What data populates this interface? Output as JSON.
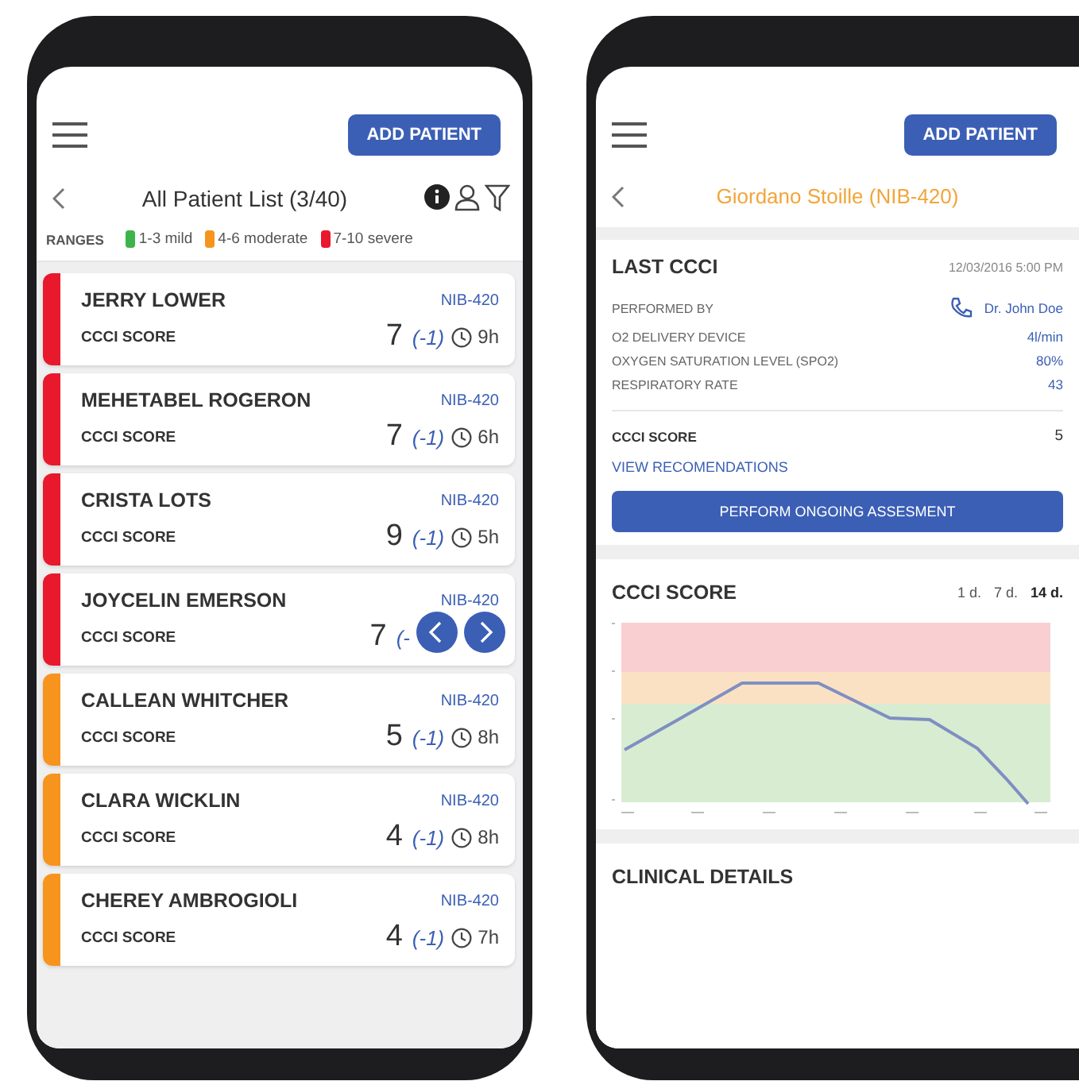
{
  "patient_list": {
    "add_button": "ADD PATIENT",
    "title": "All Patient List (3/40)",
    "ranges_label": "RANGES",
    "ranges": [
      {
        "label": "1-3 mild",
        "color": "#3cb44b"
      },
      {
        "label": "4-6 moderate",
        "color": "#f7941d"
      },
      {
        "label": "7-10 severe",
        "color": "#e8192c"
      }
    ],
    "patients": [
      {
        "name": "JERRY LOWER",
        "id": "NIB-420",
        "score_label": "CCCI SCORE",
        "score": "7",
        "change": "(-1)",
        "time": "9h",
        "color": "#e8192c"
      },
      {
        "name": "MEHETABEL ROGERON",
        "id": "NIB-420",
        "score_label": "CCCI SCORE",
        "score": "7",
        "change": "(-1)",
        "time": "6h",
        "color": "#e8192c"
      },
      {
        "name": "CRISTA LOTS",
        "id": "NIB-420",
        "score_label": "CCCI SCORE",
        "score": "9",
        "change": "(-1)",
        "time": "5h",
        "color": "#e8192c"
      },
      {
        "name": "JOYCELIN EMERSON",
        "id": "NIB-420",
        "score_label": "CCCI SCORE",
        "score": "7",
        "change": "(-",
        "color": "#e8192c"
      },
      {
        "name": "CALLEAN WHITCHER",
        "id": "NIB-420",
        "score_label": "CCCI SCORE",
        "score": "5",
        "change": "(-1)",
        "time": "8h",
        "color": "#f7941d"
      },
      {
        "name": "CLARA WICKLIN",
        "id": "NIB-420",
        "score_label": "CCCI SCORE",
        "score": "4",
        "change": "(-1)",
        "time": "8h",
        "color": "#f7941d"
      },
      {
        "name": "CHEREY AMBROGIOLI",
        "id": "NIB-420",
        "score_label": "CCCI SCORE",
        "score": "4",
        "change": "(-1)",
        "time": "7h",
        "color": "#f7941d"
      }
    ]
  },
  "patient_detail": {
    "add_button": "ADD PATIENT",
    "title": "Giordano Stoille (NIB-420)",
    "last_ccci": {
      "heading": "LAST CCCI",
      "datetime": "12/03/2016 5:00 PM",
      "rows": [
        {
          "kind": "contact",
          "label": "PERFORMED BY",
          "value": "Dr. John Doe"
        },
        {
          "kind": "plain",
          "label": "O2 DELIVERY DEVICE",
          "value": "4l/min"
        },
        {
          "kind": "plain",
          "label": "OXYGEN SATURATION LEVEL (SPO2)",
          "value": "80%"
        },
        {
          "kind": "plain",
          "label": "RESPIRATORY RATE",
          "value": "43"
        }
      ],
      "score_label": "CCCI SCORE",
      "score": "5",
      "link": "VIEW RECOMENDATIONS",
      "action_button": "PERFORM ONGOING ASSESMENT"
    },
    "score_chart": {
      "heading": "CCCI SCORE",
      "ranges": [
        {
          "label": "1 d.",
          "selected": false
        },
        {
          "label": "7 d.",
          "selected": false
        },
        {
          "label": "14 d.",
          "selected": true
        }
      ]
    },
    "clinical_details": {
      "heading": "CLINICAL DETAILS"
    }
  }
}
